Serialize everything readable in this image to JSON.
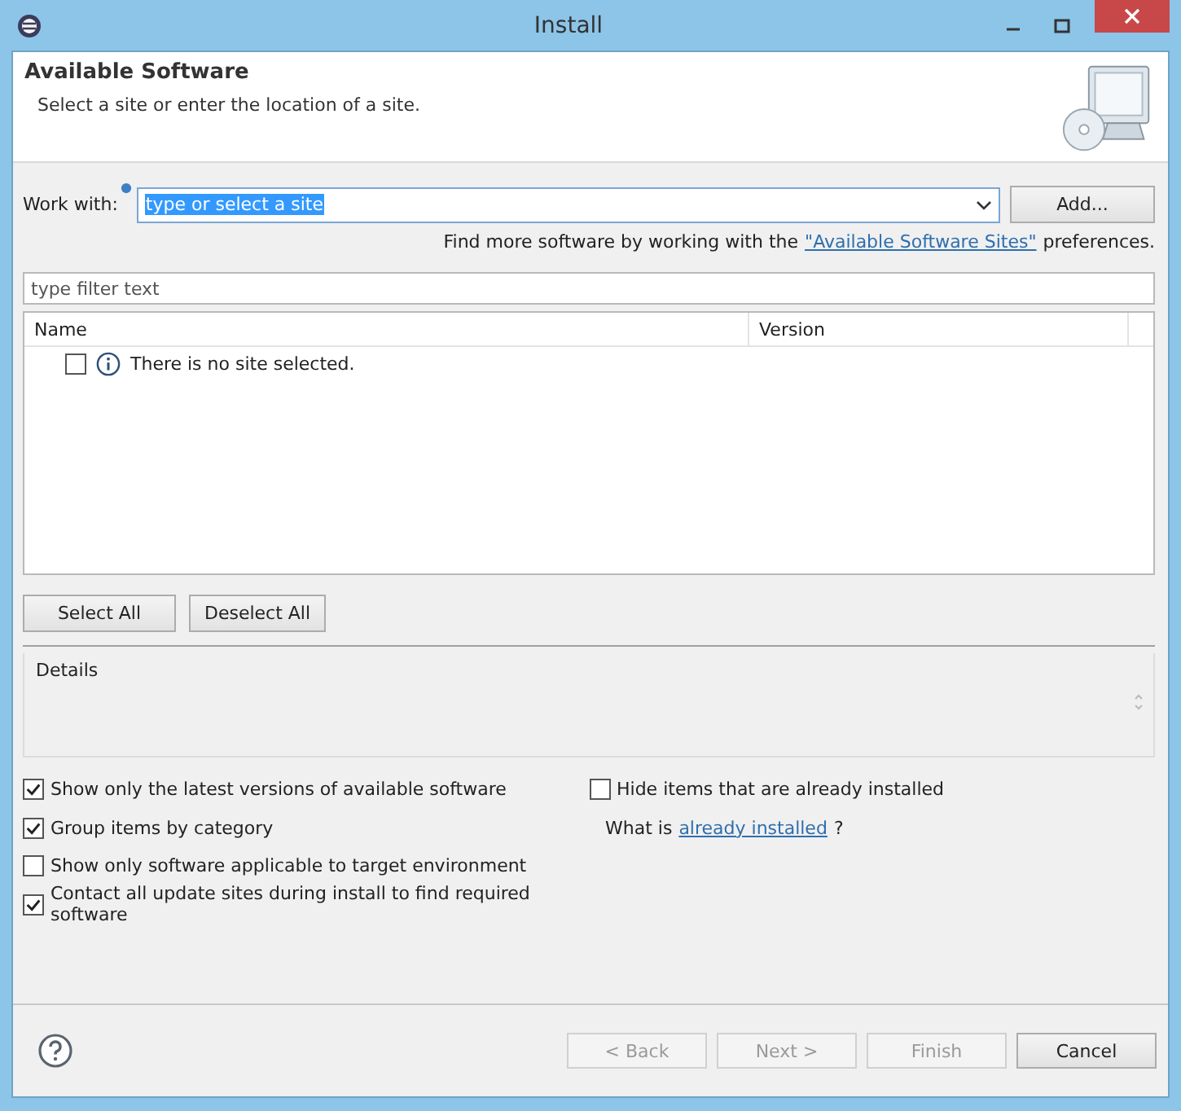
{
  "window": {
    "title": "Install"
  },
  "header": {
    "title": "Available Software",
    "subtitle": "Select a site or enter the location of a site."
  },
  "work_with": {
    "label": "Work with:",
    "value": "type or select a site",
    "button": "Add..."
  },
  "more_software": {
    "prefix": "Find more software by working with the",
    "link": "\"Available Software Sites\"",
    "suffix": "preferences."
  },
  "filter": {
    "placeholder": "type filter text"
  },
  "table": {
    "columns": [
      "Name",
      "Version"
    ],
    "rows": [
      {
        "text": "There is no site selected.",
        "checked": false
      }
    ]
  },
  "selection_buttons": [
    "Select All",
    "Deselect All"
  ],
  "details": {
    "label": "Details"
  },
  "options_left": [
    {
      "label": "Show only the latest versions of available software",
      "checked": true
    },
    {
      "label": "Group items by category",
      "checked": true
    },
    {
      "label": "Show only software applicable to target environment",
      "checked": false
    },
    {
      "label": "Contact all update sites during install to find required software",
      "checked": true
    }
  ],
  "options_right": {
    "label": "Hide items that are already installed",
    "checked": false,
    "question_prefix": "What is",
    "question_link": "already installed",
    "question_suffix": "?"
  },
  "footer_buttons": [
    {
      "label": "< Back",
      "disabled": true
    },
    {
      "label": "Next >",
      "disabled": true
    },
    {
      "label": "Finish",
      "disabled": true
    },
    {
      "label": "Cancel",
      "disabled": false
    }
  ]
}
